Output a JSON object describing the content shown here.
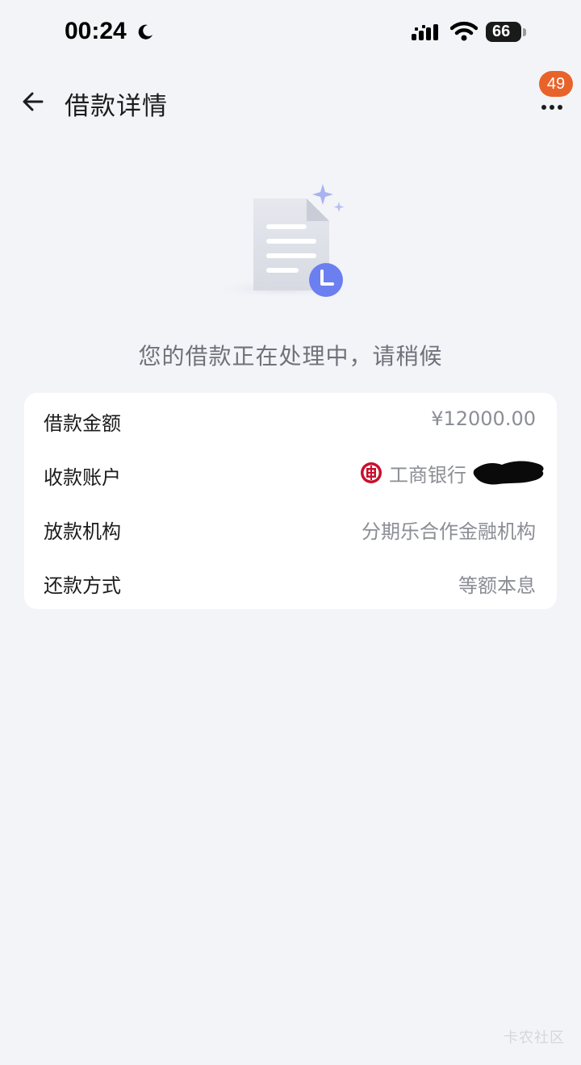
{
  "status_bar": {
    "time": "00:24",
    "battery": "66"
  },
  "header": {
    "title": "借款详情",
    "badge_count": "49"
  },
  "illustration": {
    "icon": "document-pending-icon"
  },
  "message": "您的借款正在处理中，请稍候",
  "details": [
    {
      "label": "借款金额",
      "value": "¥12000.00"
    },
    {
      "label": "收款账户",
      "bank_name": "工商银行",
      "bank_icon": "icbc-logo-icon"
    },
    {
      "label": "放款机构",
      "value": "分期乐合作金融机构"
    },
    {
      "label": "还款方式",
      "value": "等额本息"
    }
  ],
  "watermark": "卡农社区",
  "colors": {
    "background": "#f3f4f8",
    "card": "#ffffff",
    "accent_blue": "#6c7ff0",
    "badge": "#e8632a",
    "bank_red": "#c8102e",
    "secondary_text": "#8b8e95"
  }
}
